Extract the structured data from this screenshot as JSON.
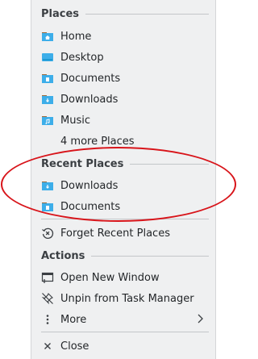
{
  "places": {
    "header": "Places",
    "items": [
      {
        "label": "Home",
        "icon": "folder-home-icon"
      },
      {
        "label": "Desktop",
        "icon": "folder-desktop-icon"
      },
      {
        "label": "Documents",
        "icon": "folder-documents-icon"
      },
      {
        "label": "Downloads",
        "icon": "folder-downloads-icon"
      },
      {
        "label": "Music",
        "icon": "folder-music-icon"
      }
    ],
    "more": "4 more Places"
  },
  "recent": {
    "header": "Recent Places",
    "items": [
      {
        "label": "Downloads",
        "icon": "folder-downloads-icon"
      },
      {
        "label": "Documents",
        "icon": "folder-documents-icon"
      }
    ],
    "forget": "Forget Recent Places"
  },
  "actions": {
    "header": "Actions",
    "open_new_window": "Open New Window",
    "unpin": "Unpin from Task Manager",
    "more": "More"
  },
  "close": "Close",
  "colors": {
    "menu_bg": "#eff0f1",
    "folder_blue": "#3daee9",
    "folder_tab": "#9f6b3a",
    "highlight_ellipse": "#d8141a"
  }
}
